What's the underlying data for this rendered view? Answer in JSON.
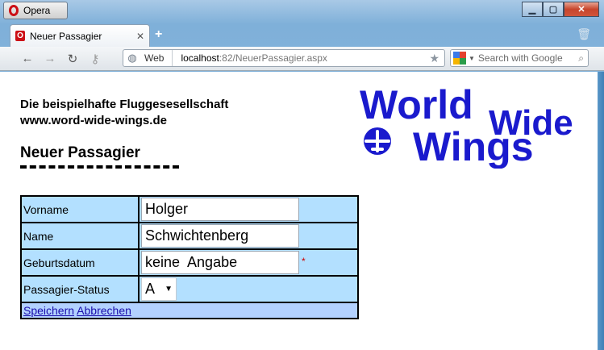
{
  "window": {
    "app_button": "Opera",
    "tab_title": "Neuer Passagier",
    "address_mode": "Web",
    "url_host": "localhost",
    "url_path": ":82/NeuerPassagier.aspx",
    "search_placeholder": "Search with Google"
  },
  "page": {
    "company_line1": "Die beispielhafte Fluggesesellschaft",
    "company_line2": "www.word-wide-wings.de",
    "title": "Neuer Passagier",
    "logo_line1": "World",
    "logo_line1b": "Wide",
    "logo_line2": "Wings"
  },
  "form": {
    "fields": [
      {
        "label": "Vorname",
        "value": "Holger"
      },
      {
        "label": "Name",
        "value": "Schwichtenberg"
      },
      {
        "label": "Geburtsdatum",
        "value": "keine  Angabe",
        "required_marker": "*"
      },
      {
        "label": "Passagier-Status",
        "value": "A"
      }
    ],
    "save_label": "Speichern",
    "cancel_label": "Abbrechen"
  },
  "colors": {
    "form_bg": "#b3e0ff",
    "actions_bg": "#b3d1ff",
    "logo_blue": "#1a1acd"
  }
}
